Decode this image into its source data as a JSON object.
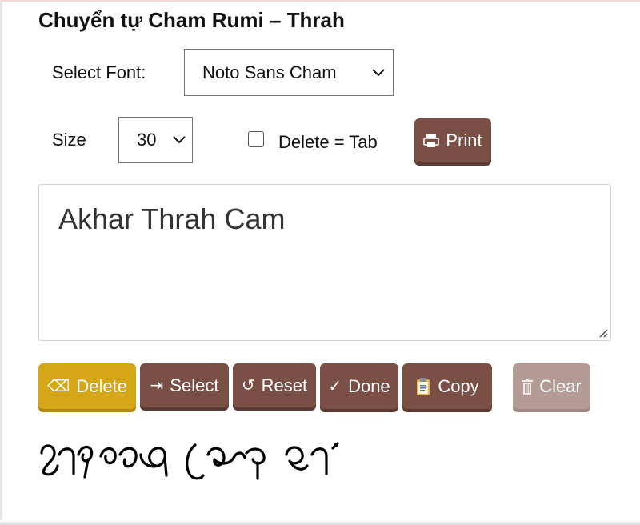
{
  "title": "Chuyển tự Cham Rumi – Thrah",
  "font_select": {
    "label": "Select Font:",
    "value": "Noto Sans Cham"
  },
  "size_select": {
    "label": "Size",
    "value": "30"
  },
  "delete_tab": {
    "label": "Delete = Tab",
    "checked": false
  },
  "print_button": {
    "icon": "printer-icon",
    "label": "Print"
  },
  "editor": {
    "text": "Akhar Thrah Cam"
  },
  "actions": {
    "delete": {
      "icon": "backspace-icon",
      "glyph": "⌫",
      "label": "Delete"
    },
    "select": {
      "icon": "tab-arrow-icon",
      "glyph": "⇥",
      "label": "Select"
    },
    "reset": {
      "icon": "reset-icon",
      "glyph": "↺",
      "label": "Reset"
    },
    "done": {
      "icon": "check-icon",
      "glyph": "✓",
      "label": "Done"
    },
    "copy": {
      "icon": "clipboard-icon",
      "label": "Copy"
    },
    "clear": {
      "icon": "trash-icon",
      "label": "Clear"
    }
  },
  "colors": {
    "brown": "#7a4f46",
    "yellow": "#d4a618",
    "faded_brown": "#b59b96"
  }
}
